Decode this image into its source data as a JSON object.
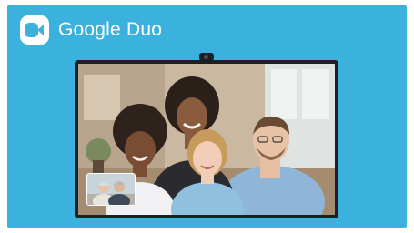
{
  "app": {
    "name": "Google Duo",
    "logo_icon": "duo-camera-icon"
  },
  "colors": {
    "background": "#3bb2de",
    "tv_frame": "#1d1f23"
  }
}
